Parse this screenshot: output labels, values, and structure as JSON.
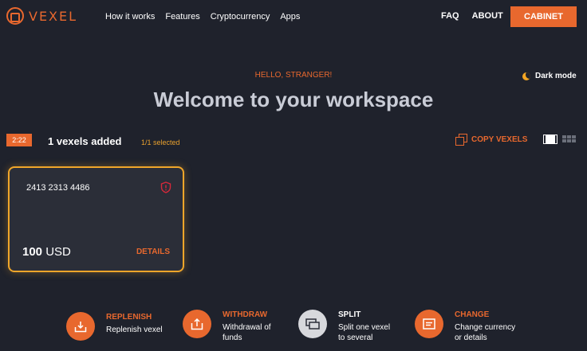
{
  "brand": {
    "logo_text": "VEXEL",
    "accent": "#e8682e"
  },
  "nav": {
    "links": [
      "How it works",
      "Features",
      "Cryptocurrency",
      "Apps"
    ],
    "faq": "FAQ",
    "about": "ABOUT",
    "cabinet": "CABINET"
  },
  "hero": {
    "greeting": "HELLO, STRANGER!",
    "title": "Welcome to your workspace",
    "dark_mode": "Dark mode"
  },
  "toolbar": {
    "timer": "2:22",
    "count": "1 vexels added",
    "selected": "1/1 selected",
    "copy": "COPY VEXELS"
  },
  "card": {
    "number": "2413 2313 4486",
    "amount": "100",
    "currency": "USD",
    "details": "DETAILS",
    "border_color": "#f0a62a"
  },
  "actions": [
    {
      "title": "REPLENISH",
      "desc": [
        "Replenish vexel"
      ],
      "icon": "download-icon"
    },
    {
      "title": "WITHDRAW",
      "desc": [
        "Withdrawal of",
        "funds"
      ],
      "icon": "upload-icon"
    },
    {
      "title": "SPLIT",
      "desc": [
        "Split one vexel",
        "to several"
      ],
      "icon": "split-cards-icon"
    },
    {
      "title": "CHANGE",
      "desc": [
        "Change currency",
        "or details"
      ],
      "icon": "card-edit-icon"
    }
  ]
}
